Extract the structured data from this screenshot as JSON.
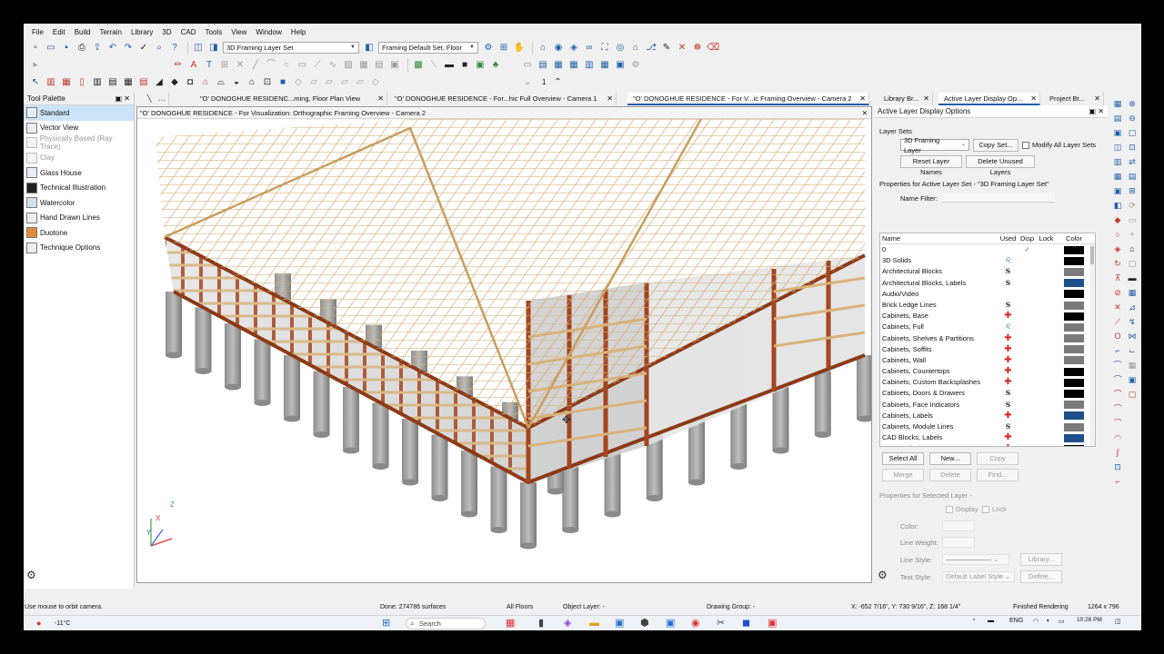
{
  "menu": [
    "File",
    "Edit",
    "Build",
    "Terrain",
    "Library",
    "3D",
    "CAD",
    "Tools",
    "View",
    "Window",
    "Help"
  ],
  "toolbar": {
    "layer_set": "3D Framing Layer Set",
    "framing_default_set": "Framing Default Set, Floor",
    "floor_number": "1"
  },
  "tabs": {
    "tab1": "\"O' DONOGHUE RESIDENC...ming, Floor Plan View",
    "tab2": "\"O' DONOGHUE RESIDENCE - For...hic Full Overview - Camera 1",
    "tab3": "\"O' DONOGHUE RESIDENCE - For V...ic Framing Overview - Camera 2",
    "right1": "Library Br...",
    "right2": "Active Layer Display Op...",
    "right3": "Project Br..."
  },
  "palette": {
    "title": "Tool Palette",
    "items": [
      "Standard",
      "Vector View",
      "Physically Based (Ray Trace)",
      "Clay",
      "Glass House",
      "Technical Illustration",
      "Watercolor",
      "Hand Drawn Lines",
      "Duotone",
      "Technique Options"
    ]
  },
  "view": {
    "title": "\"O' DONOGHUE RESIDENCE - For Visualization: Orthographic Framing Overview - Camera 2",
    "axis_x": "X",
    "axis_y": "Y",
    "axis_z": "Z"
  },
  "layer_panel": {
    "title": "Active Layer Display Options",
    "layer_sets_label": "Layer Sets",
    "layer_set_value": "3D Framing Layer",
    "copy_set": "Copy Set...",
    "modify_all": "Modify All Layer Sets",
    "reset_names": "Reset Layer Names",
    "delete_unused": "Delete Unused Layers",
    "properties_active": "Properties for Active Layer Set - \"3D Framing Layer Set\"",
    "name_filter": "Name Filter:",
    "columns": [
      "Name",
      "Used",
      "Disp",
      "Lock",
      "Color"
    ],
    "layers": [
      {
        "name": "0",
        "used": "",
        "disp": "✓",
        "color": "#000000"
      },
      {
        "name": "3D Solids",
        "used": "L",
        "disp": "",
        "color": "#000000"
      },
      {
        "name": "Architectural Blocks",
        "used": "S",
        "disp": "",
        "color": "#7a7a7a"
      },
      {
        "name": "Architectural Blocks, Labels",
        "used": "S",
        "disp": "",
        "color": "#1f4f8a"
      },
      {
        "name": "Audio/Video",
        "used": "",
        "disp": "",
        "color": "#000000"
      },
      {
        "name": "Brick Ledge Lines",
        "used": "S",
        "disp": "",
        "color": "#7a7a7a"
      },
      {
        "name": "Cabinets,  Base",
        "used": "P",
        "disp": "",
        "color": "#000000"
      },
      {
        "name": "Cabinets,  Full",
        "used": "L",
        "disp": "",
        "color": "#7a7a7a"
      },
      {
        "name": "Cabinets,  Shelves & Partitions",
        "used": "P",
        "disp": "",
        "color": "#7a7a7a"
      },
      {
        "name": "Cabinets,  Soffits",
        "used": "P",
        "disp": "",
        "color": "#7a7a7a"
      },
      {
        "name": "Cabinets,  Wall",
        "used": "P",
        "disp": "",
        "color": "#7a7a7a"
      },
      {
        "name": "Cabinets, Countertops",
        "used": "P",
        "disp": "",
        "color": "#000000"
      },
      {
        "name": "Cabinets, Custom Backsplashes",
        "used": "P",
        "disp": "",
        "color": "#000000"
      },
      {
        "name": "Cabinets, Doors & Drawers",
        "used": "S",
        "disp": "",
        "color": "#000000"
      },
      {
        "name": "Cabinets, Face Indicators",
        "used": "S",
        "disp": "",
        "color": "#7a7a7a"
      },
      {
        "name": "Cabinets, Labels",
        "used": "P",
        "disp": "",
        "color": "#1f4f8a"
      },
      {
        "name": "Cabinets, Module Lines",
        "used": "S",
        "disp": "",
        "color": "#7a7a7a"
      },
      {
        "name": "CAD Blocks, Labels",
        "used": "P",
        "disp": "",
        "color": "#1f4f8a"
      },
      {
        "name": "CAD, Default",
        "used": "P",
        "disp": "",
        "color": "#000000"
      }
    ],
    "buttons": {
      "select_all": "Select All",
      "new": "New...",
      "copy": "Copy",
      "merge": "Merge",
      "delete": "Delete",
      "find": "Find..."
    },
    "properties_selected": "Properties for Selected Layer -",
    "display": "Display",
    "lock": "Lock",
    "color_label": "Color:",
    "line_weight_label": "Line Weight:",
    "line_style_label": "Line Style:",
    "library": "Library...",
    "text_style_label": "Text Style:",
    "text_style_value": "Default Label Style",
    "define": "Define..."
  },
  "status": {
    "hint": "Use mouse to orbit camera.",
    "done": "Done:  274786 surfaces",
    "floors": "All Floors",
    "object_layer": "Object Layer: -",
    "drawing_group": "Drawing Group: -",
    "coords": "X: -652 7/16\", Y: 730 9/16\", Z: 168 1/4\"",
    "rendering": "Finished Rendering",
    "size": "1264 x 796"
  },
  "taskbar": {
    "temp": "-11°C",
    "search": "Search",
    "lang": "ENG",
    "time": "10:26 PM"
  }
}
